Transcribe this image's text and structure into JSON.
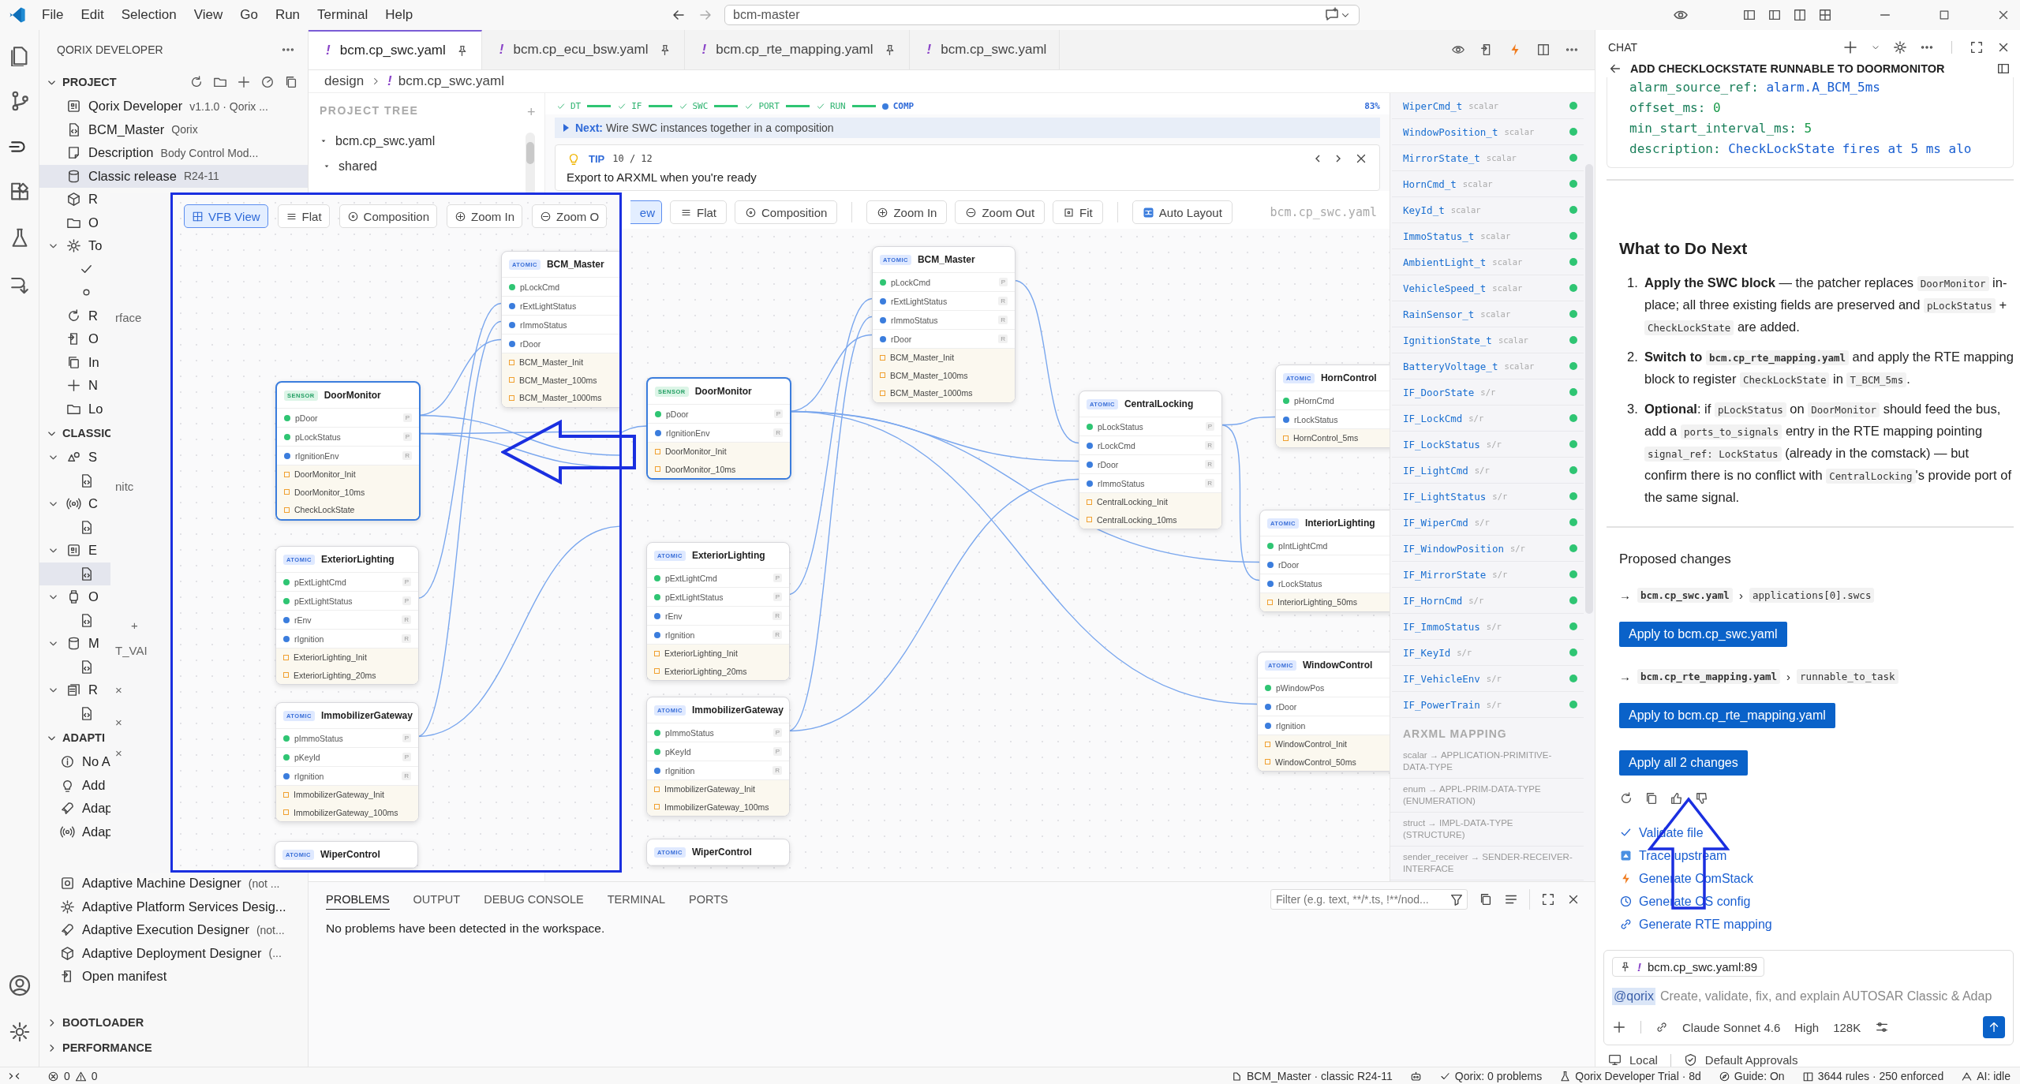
{
  "menu": {
    "items": [
      "File",
      "Edit",
      "Selection",
      "View",
      "Go",
      "Run",
      "Terminal",
      "Help"
    ],
    "command_center": "bcm-master"
  },
  "sidebar": {
    "title": "QORIX DEVELOPER",
    "sections": [
      {
        "title": "PROJECT",
        "expanded": true,
        "items": [
          {
            "kind": "board",
            "label": "Qorix Developer",
            "detail": "v1.1.0 · Qorix ...",
            "selected": false
          },
          {
            "kind": "codefile",
            "label": "BCM_Master",
            "detail": "Qorix",
            "selected": false
          },
          {
            "kind": "note",
            "label": "Description",
            "detail": "Body Control Mod...",
            "selected": false
          },
          {
            "kind": "db",
            "label": "Classic release",
            "detail": "R24-11",
            "selected": true
          },
          {
            "kind": "cube",
            "label": "R",
            "selected": false
          },
          {
            "kind": "folder",
            "label": "O",
            "selected": false
          },
          {
            "kind": "gear",
            "label": "To",
            "expanded": true,
            "selected": false,
            "children": [
              {
                "kind": "check",
                "selected": false
              },
              {
                "kind": "circle",
                "selected": false
              }
            ]
          },
          {
            "kind": "refresh",
            "label": "R",
            "selected": false
          },
          {
            "kind": "export",
            "label": "O",
            "selected": false
          },
          {
            "kind": "copy",
            "label": "In",
            "selected": false
          },
          {
            "kind": "plus",
            "label": "N",
            "selected": false
          },
          {
            "kind": "folder",
            "label": "Lo",
            "selected": false
          }
        ]
      },
      {
        "title": "CLASSIC",
        "expanded": true,
        "items": [
          {
            "kind": "shapes",
            "label": "S",
            "expanded": true,
            "selected": false,
            "children": [
              {
                "kind": "codefile",
                "selected": false
              }
            ]
          },
          {
            "kind": "antenna",
            "label": "C",
            "expanded": true,
            "selected": false,
            "children": [
              {
                "kind": "codefile",
                "selected": false
              }
            ]
          },
          {
            "kind": "board",
            "label": "E",
            "expanded": true,
            "selected": false,
            "children": [
              {
                "kind": "codefile",
                "selected": true
              }
            ]
          },
          {
            "kind": "watch",
            "label": "O",
            "expanded": true,
            "selected": false,
            "children": [
              {
                "kind": "codefile",
                "selected": false
              }
            ]
          },
          {
            "kind": "db",
            "label": "M",
            "expanded": true,
            "selected": false,
            "children": [
              {
                "kind": "codefile",
                "selected": false
              }
            ]
          },
          {
            "kind": "gallery",
            "label": "R",
            "expanded": true,
            "selected": false,
            "children": [
              {
                "kind": "codefile",
                "selected": false
              }
            ]
          }
        ]
      },
      {
        "title": "ADAPTI",
        "expanded": true,
        "items": [
          {
            "kind": "info",
            "label": "No A",
            "selected": false
          },
          {
            "kind": "bulb",
            "label": "Add",
            "selected": false
          },
          {
            "kind": "rocket",
            "label": "Adap",
            "selected": false
          },
          {
            "kind": "antenna",
            "label": "Adap",
            "selected": false
          },
          {
            "kind": "gearbox",
            "label": "Adaptive Machine Designer",
            "detail": "(not ...",
            "selected": false
          },
          {
            "kind": "gear",
            "label": "Adaptive Platform Services Desig...",
            "selected": false
          },
          {
            "kind": "rocket",
            "label": "Adaptive Execution Designer",
            "detail": "(not...",
            "selected": false
          },
          {
            "kind": "cube",
            "label": "Adaptive Deployment Designer",
            "detail": "(...",
            "selected": false
          },
          {
            "kind": "export",
            "label": "Open manifest",
            "selected": false
          }
        ]
      },
      {
        "title": "BOOTLOADER",
        "expanded": false
      },
      {
        "title": "PERFORMANCE",
        "expanded": false
      }
    ]
  },
  "editor": {
    "tabs": [
      {
        "mark": "!",
        "label": "bcm.cp_swc.yaml",
        "pinned": true,
        "selected": true
      },
      {
        "mark": "!",
        "label": "bcm.cp_ecu_bsw.yaml",
        "pinned": true,
        "selected": false
      },
      {
        "mark": "!",
        "label": "bcm.cp_rte_mapping.yaml",
        "pinned": true,
        "selected": false
      },
      {
        "mark": "!",
        "label": "bcm.cp_swc.yaml",
        "pinned": false,
        "selected": false
      }
    ],
    "breadcrumb": {
      "folder": "design",
      "mark": "!",
      "file": "bcm.cp_swc.yaml"
    },
    "project_tree": {
      "title": "PROJECT TREE",
      "add": "+",
      "items": [
        "bcm.cp_swc.yaml",
        "shared"
      ]
    },
    "steps": [
      {
        "label": "DT",
        "done": true
      },
      {
        "label": "IF",
        "done": true
      },
      {
        "label": "SWC",
        "done": true
      },
      {
        "label": "PORT",
        "done": true
      },
      {
        "label": "RUN",
        "done": true
      },
      {
        "label": "COMP",
        "done": false
      }
    ],
    "progress": "83%",
    "next": {
      "label": "Next:",
      "text": "Wire SWC instances together in a composition"
    },
    "tip": {
      "label": "TIP",
      "counter": "10 / 12",
      "text": "Export to ARXML when you're ready"
    },
    "toolbar": [
      {
        "label": "ew",
        "selected": true
      },
      {
        "label": "Flat",
        "kind": "flat",
        "selected": false
      },
      {
        "label": "Composition",
        "kind": "composition",
        "selected": false
      },
      {
        "label": "Zoom In",
        "kind": "zoomin",
        "selected": false
      },
      {
        "label": "Zoom Out",
        "kind": "zoomout",
        "selected": false
      },
      {
        "label": "Fit",
        "kind": "fit",
        "selected": false
      },
      {
        "label": "Auto Layout",
        "kind": "auto",
        "selected": false
      }
    ],
    "file_label": "bcm.cp_swc.yaml",
    "nodes": [
      {
        "badge": "ATOMIC",
        "kind": "atomic",
        "name": "BCM_Master",
        "selected": false,
        "ports": [
          {
            "name": "pLockCmd",
            "kind": "provide",
            "tag": "P"
          },
          {
            "name": "rExtLightStatus",
            "kind": "require",
            "tag": "R"
          },
          {
            "name": "rImmoStatus",
            "kind": "require",
            "tag": "R"
          },
          {
            "name": "rDoor",
            "kind": "require",
            "tag": "R"
          }
        ],
        "runnables": [
          "BCM_Master_Init",
          "BCM_Master_100ms",
          "BCM_Master_1000ms"
        ]
      },
      {
        "badge": "SENSOR",
        "kind": "sensor",
        "name": "DoorMonitor",
        "selected": true,
        "ports": [
          {
            "name": "pDoor",
            "kind": "provide",
            "tag": "P"
          },
          {
            "name": "rIgnitionEnv",
            "kind": "require",
            "tag": "R"
          }
        ],
        "runnables": [
          "DoorMonitor_Init",
          "DoorMonitor_10ms"
        ]
      },
      {
        "badge": "ATOMIC",
        "kind": "atomic",
        "name": "ExteriorLighting",
        "selected": false,
        "ports": [
          {
            "name": "pExtLightCmd",
            "kind": "provide",
            "tag": "P"
          },
          {
            "name": "pExtLightStatus",
            "kind": "provide",
            "tag": "P"
          },
          {
            "name": "rEnv",
            "kind": "require",
            "tag": "R"
          },
          {
            "name": "rIgnition",
            "kind": "require",
            "tag": "R"
          }
        ],
        "runnables": [
          "ExteriorLighting_Init",
          "ExteriorLighting_20ms"
        ]
      },
      {
        "badge": "ATOMIC",
        "kind": "atomic",
        "name": "ImmobilizerGateway",
        "selected": false,
        "ports": [
          {
            "name": "pImmoStatus",
            "kind": "provide",
            "tag": "P"
          },
          {
            "name": "pKeyId",
            "kind": "provide",
            "tag": "P"
          },
          {
            "name": "rIgnition",
            "kind": "require",
            "tag": "R"
          }
        ],
        "runnables": [
          "ImmobilizerGateway_Init",
          "ImmobilizerGateway_100ms"
        ]
      },
      {
        "badge": "ATOMIC",
        "kind": "atomic",
        "name": "WiperControl",
        "selected": false
      },
      {
        "badge": "ATOMIC",
        "kind": "atomic",
        "name": "CentralLocking",
        "selected": false,
        "ports": [
          {
            "name": "pLockStatus",
            "kind": "provide",
            "tag": "P"
          },
          {
            "name": "rLockCmd",
            "kind": "require",
            "tag": "R"
          },
          {
            "name": "rDoor",
            "kind": "require",
            "tag": "R"
          },
          {
            "name": "rImmoStatus",
            "kind": "require",
            "tag": "R"
          }
        ],
        "runnables": [
          "CentralLocking_Init",
          "CentralLocking_10ms"
        ]
      },
      {
        "badge": "ATOMIC",
        "kind": "atomic",
        "name": "HornControl",
        "selected": false,
        "ports": [
          {
            "name": "pHornCmd",
            "kind": "provide"
          },
          {
            "name": "rLockStatus",
            "kind": "require"
          }
        ],
        "runnables": [
          "HornControl_5ms"
        ]
      },
      {
        "badge": "ATOMIC",
        "kind": "atomic",
        "name": "InteriorLighting",
        "selected": false,
        "ports": [
          {
            "name": "pIntLightCmd",
            "kind": "provide"
          },
          {
            "name": "rDoor",
            "kind": "require"
          },
          {
            "name": "rLockStatus",
            "kind": "require"
          }
        ],
        "runnables": [
          "InteriorLighting_50ms"
        ]
      },
      {
        "badge": "ATOMIC",
        "kind": "atomic",
        "name": "WindowControl",
        "selected": false,
        "ports": [
          {
            "name": "pWindowPos",
            "kind": "provide"
          },
          {
            "name": "rDoor",
            "kind": "require"
          },
          {
            "name": "rIgnition",
            "kind": "require"
          }
        ],
        "runnables": [
          "WindowControl_Init",
          "WindowControl_50ms"
        ]
      }
    ],
    "types": [
      {
        "name": "WiperCmd_t",
        "kind": "scalar",
        "ok": true
      },
      {
        "name": "WindowPosition_t",
        "kind": "scalar",
        "ok": true
      },
      {
        "name": "MirrorState_t",
        "kind": "scalar",
        "ok": true
      },
      {
        "name": "HornCmd_t",
        "kind": "scalar",
        "ok": true
      },
      {
        "name": "KeyId_t",
        "kind": "scalar",
        "ok": true
      },
      {
        "name": "ImmoStatus_t",
        "kind": "scalar",
        "ok": true
      },
      {
        "name": "AmbientLight_t",
        "kind": "scalar",
        "ok": true
      },
      {
        "name": "VehicleSpeed_t",
        "kind": "scalar",
        "ok": true
      },
      {
        "name": "RainSensor_t",
        "kind": "scalar",
        "ok": true
      },
      {
        "name": "IgnitionState_t",
        "kind": "scalar",
        "ok": true
      },
      {
        "name": "BatteryVoltage_t",
        "kind": "scalar",
        "ok": true
      },
      {
        "name": "IF_DoorState",
        "kind": "s/r",
        "ok": true
      },
      {
        "name": "IF_LockCmd",
        "kind": "s/r",
        "ok": true
      },
      {
        "name": "IF_LockStatus",
        "kind": "s/r",
        "ok": true
      },
      {
        "name": "IF_LightCmd",
        "kind": "s/r",
        "ok": true
      },
      {
        "name": "IF_LightStatus",
        "kind": "s/r",
        "ok": true
      },
      {
        "name": "IF_WiperCmd",
        "kind": "s/r",
        "ok": true
      },
      {
        "name": "IF_WindowPosition",
        "kind": "s/r",
        "ok": true
      },
      {
        "name": "IF_MirrorState",
        "kind": "s/r",
        "ok": true
      },
      {
        "name": "IF_HornCmd",
        "kind": "s/r",
        "ok": true
      },
      {
        "name": "IF_ImmoStatus",
        "kind": "s/r",
        "ok": true
      },
      {
        "name": "IF_KeyId",
        "kind": "s/r",
        "ok": true
      },
      {
        "name": "IF_VehicleEnv",
        "kind": "s/r",
        "ok": true
      },
      {
        "name": "IF_PowerTrain",
        "kind": "s/r",
        "ok": true
      }
    ],
    "mapping": {
      "title": "ARXML MAPPING",
      "items": [
        "scalar → APPLICATION-PRIMITIVE-DATA-TYPE",
        "enum → APPL-PRIM-DATA-TYPE (ENUMERATION)",
        "struct → IMPL-DATA-TYPE (STRUCTURE)",
        "sender_receiver → SENDER-RECEIVER-INTERFACE"
      ]
    }
  },
  "inset": {
    "fragments": [
      "rface",
      "nitc",
      "+",
      "T_VAI",
      "×",
      "×",
      "×"
    ],
    "toolbar": [
      {
        "label": "VFB View",
        "kind": "view",
        "selected": true
      },
      {
        "label": "Flat",
        "kind": "flat",
        "selected": false
      },
      {
        "label": "Composition",
        "kind": "composition",
        "selected": false
      },
      {
        "label": "Zoom In",
        "kind": "zoomin",
        "selected": false
      },
      {
        "label": "Zoom O",
        "kind": "zoomout",
        "selected": false
      }
    ],
    "nodes": [
      {
        "badge": "ATOMIC",
        "kind": "atomic",
        "name": "BCM_Master",
        "selected": false,
        "ports": [
          {
            "name": "pLockCmd",
            "kind": "provide"
          },
          {
            "name": "rExtLightStatus",
            "kind": "require"
          },
          {
            "name": "rImmoStatus",
            "kind": "require"
          },
          {
            "name": "rDoor",
            "kind": "require"
          }
        ],
        "runnables": [
          "BCM_Master_Init",
          "BCM_Master_100ms",
          "BCM_Master_1000ms"
        ]
      },
      {
        "badge": "SENSOR",
        "kind": "sensor",
        "name": "DoorMonitor",
        "selected": true,
        "ports": [
          {
            "name": "pDoor",
            "kind": "provide",
            "tag": "P"
          },
          {
            "name": "pLockStatus",
            "kind": "provide",
            "tag": "P"
          },
          {
            "name": "rIgnitionEnv",
            "kind": "require",
            "tag": "R"
          }
        ],
        "runnables": [
          "DoorMonitor_Init",
          "DoorMonitor_10ms",
          "CheckLockState"
        ]
      },
      {
        "badge": "ATOMIC",
        "kind": "atomic",
        "name": "ExteriorLighting",
        "selected": false,
        "ports": [
          {
            "name": "pExtLightCmd",
            "kind": "provide",
            "tag": "P"
          },
          {
            "name": "pExtLightStatus",
            "kind": "provide",
            "tag": "P"
          },
          {
            "name": "rEnv",
            "kind": "require",
            "tag": "R"
          },
          {
            "name": "rIgnition",
            "kind": "require",
            "tag": "R"
          }
        ],
        "runnables": [
          "ExteriorLighting_Init",
          "ExteriorLighting_20ms"
        ]
      },
      {
        "badge": "ATOMIC",
        "kind": "atomic",
        "name": "ImmobilizerGateway",
        "selected": false,
        "ports": [
          {
            "name": "pImmoStatus",
            "kind": "provide",
            "tag": "P"
          },
          {
            "name": "pKeyId",
            "kind": "provide",
            "tag": "P"
          },
          {
            "name": "rIgnition",
            "kind": "require",
            "tag": "R"
          }
        ],
        "runnables": [
          "ImmobilizerGateway_Init",
          "ImmobilizerGateway_100ms"
        ]
      },
      {
        "badge": "ATOMIC",
        "kind": "atomic",
        "name": "WiperControl",
        "selected": false
      }
    ]
  },
  "panel": {
    "tabs": [
      {
        "label": "PROBLEMS",
        "selected": true
      },
      {
        "label": "OUTPUT",
        "selected": false
      },
      {
        "label": "DEBUG CONSOLE",
        "selected": false
      },
      {
        "label": "TERMINAL",
        "selected": false
      },
      {
        "label": "PORTS",
        "selected": false
      }
    ],
    "filter_placeholder": "Filter (e.g. text, **/*.ts, !**/nod...",
    "message": "No problems have been detected in the workspace."
  },
  "chat": {
    "title": "CHAT",
    "thread_title": "ADD CHECKLOCKSTATE RUNNABLE TO DOORMONITOR",
    "code": [
      {
        "key": "alarm_source_ref:",
        "value": "alarm.A_BCM_5ms",
        "kind": "string"
      },
      {
        "key": "offset_ms:",
        "value": "0",
        "kind": "number"
      },
      {
        "key": "min_start_interval_ms:",
        "value": "5",
        "kind": "number"
      },
      {
        "key": "description:",
        "value": "CheckLockState fires at 5 ms alo",
        "kind": "string"
      }
    ],
    "heading": "What to Do Next",
    "steps": [
      {
        "marker": "1.",
        "parts": [
          {
            "kind": "bold",
            "text": "Apply the SWC block"
          },
          {
            "kind": "text",
            "text": " — the patcher replaces "
          },
          {
            "kind": "code",
            "text": "DoorMonitor"
          },
          {
            "kind": "text",
            "text": " in-place; all three existing fields are preserved and "
          },
          {
            "kind": "code",
            "text": "pLockStatus"
          },
          {
            "kind": "text",
            "text": " + "
          },
          {
            "kind": "code",
            "text": "CheckLockState"
          },
          {
            "kind": "text",
            "text": " are added."
          }
        ]
      },
      {
        "marker": "2.",
        "parts": [
          {
            "kind": "bold",
            "text": "Switch to "
          },
          {
            "kind": "code_bold",
            "text": "bcm.cp_rte_mapping.yaml"
          },
          {
            "kind": "text",
            "text": " and apply the RTE mapping block to register "
          },
          {
            "kind": "code",
            "text": "CheckLockState"
          },
          {
            "kind": "text",
            "text": " in "
          },
          {
            "kind": "code",
            "text": "T_BCM_5ms"
          },
          {
            "kind": "text",
            "text": "."
          }
        ]
      },
      {
        "marker": "3.",
        "parts": [
          {
            "kind": "bold",
            "text": "Optional"
          },
          {
            "kind": "text",
            "text": ": if "
          },
          {
            "kind": "code",
            "text": "pLockStatus"
          },
          {
            "kind": "text",
            "text": " on "
          },
          {
            "kind": "code",
            "text": "DoorMonitor"
          },
          {
            "kind": "text",
            "text": " should feed the bus, add a "
          },
          {
            "kind": "code",
            "text": "ports_to_signals"
          },
          {
            "kind": "text",
            "text": " entry in the RTE mapping pointing "
          },
          {
            "kind": "code",
            "text": "signal_ref: LockStatus"
          },
          {
            "kind": "text",
            "text": " (already in the comstack) — but confirm there is no conflict with "
          },
          {
            "kind": "code",
            "text": "CentralLocking"
          },
          {
            "kind": "text",
            "text": "'s provide port of the same signal."
          }
        ]
      }
    ],
    "proposed_title": "Proposed changes",
    "changes": [
      {
        "marker": "→",
        "file": "bcm.cp_swc.yaml",
        "sep": "›",
        "path": "applications[0].swcs",
        "button": "Apply to bcm.cp_swc.yaml"
      },
      {
        "marker": "→",
        "file": "bcm.cp_rte_mapping.yaml",
        "sep": "›",
        "path": "runnable_to_task",
        "button": "Apply to bcm.cp_rte_mapping.yaml"
      }
    ],
    "apply_all": "Apply all 2 changes",
    "actions": [
      {
        "kind": "check",
        "label": "Validate file"
      },
      {
        "kind": "upstream",
        "label": "Trace upstream"
      },
      {
        "kind": "bolt",
        "label": "Generate ComStack"
      },
      {
        "kind": "clock",
        "label": "Generate OS config"
      },
      {
        "kind": "link",
        "label": "Generate RTE mapping"
      }
    ],
    "attachment": {
      "mark": "!",
      "label": "bcm.cp_swc.yaml:89"
    },
    "mention": "@qorix",
    "placeholder": "Create, validate, fix, and explain AUTOSAR Classic & Adap",
    "model": "Claude Sonnet 4.6",
    "effort": "High",
    "context": "128K",
    "footer": [
      "Local",
      "Default Approvals"
    ]
  },
  "status": {
    "errors": "0",
    "warnings": "0",
    "items": [
      {
        "kind": "branch",
        "label": "BCM_Master · classic R24-11"
      },
      {
        "kind": "robot"
      },
      {
        "kind": "check",
        "label": "Qorix: 0 problems"
      },
      {
        "kind": "flask",
        "label": "Qorix Developer Trial · 8d"
      },
      {
        "kind": "compass",
        "label": "Guide: On"
      },
      {
        "kind": "book",
        "label": "3644 rules · 250 enforced"
      },
      {
        "kind": "ai",
        "label": "AI: idle"
      }
    ]
  }
}
